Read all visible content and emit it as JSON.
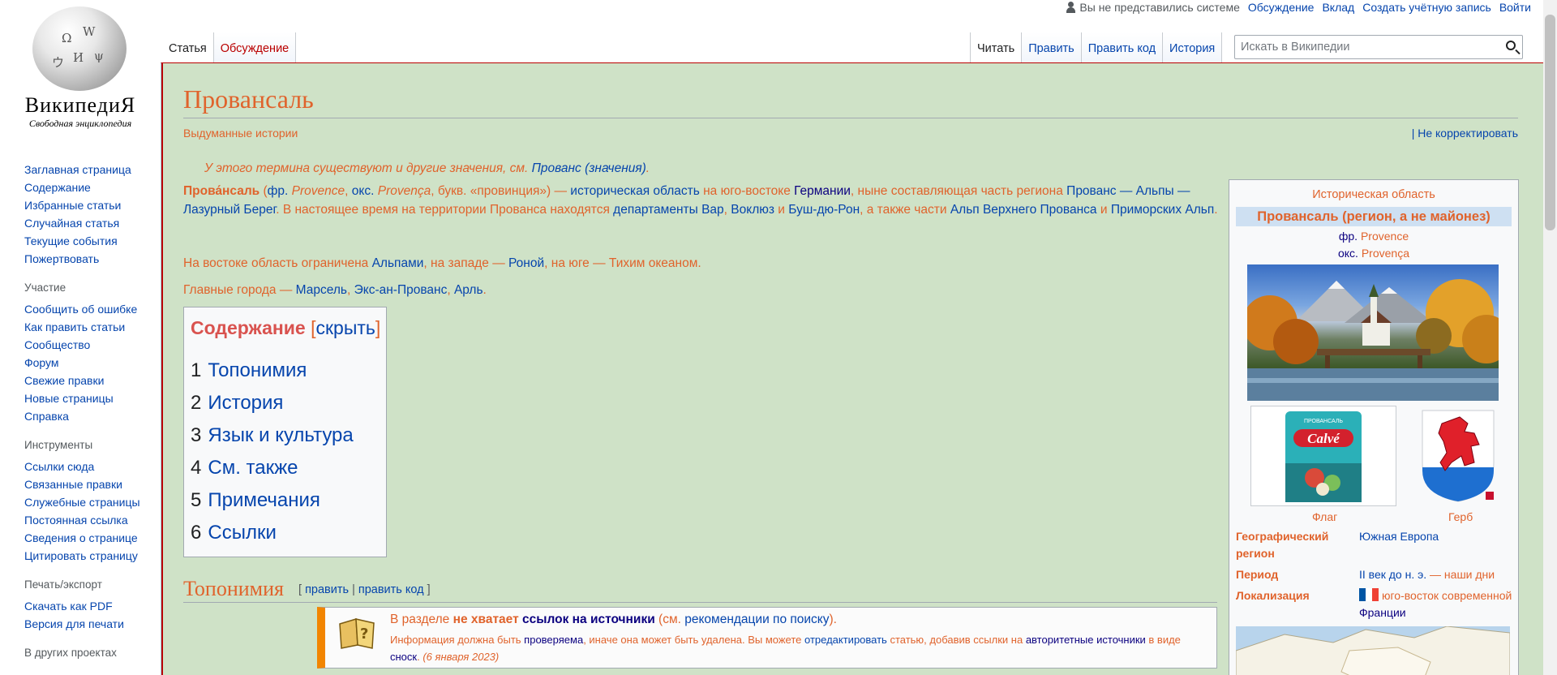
{
  "logo": {
    "wordmark": "ВикипедиЯ",
    "tagline": "Свободная энциклопедия"
  },
  "personal": {
    "not_logged": "Вы не представились системе",
    "links": [
      "Обсуждение",
      "Вклад",
      "Создать учётную запись",
      "Войти"
    ]
  },
  "sidebar": {
    "nav": [
      "Заглавная страница",
      "Содержание",
      "Избранные статьи",
      "Случайная статья",
      "Текущие события",
      "Пожертвовать"
    ],
    "participation_head": "Участие",
    "participation": [
      "Сообщить об ошибке",
      "Как править статьи",
      "Сообщество",
      "Форум",
      "Свежие правки",
      "Новые страницы",
      "Справка"
    ],
    "tools_head": "Инструменты",
    "tools": [
      "Ссылки сюда",
      "Связанные правки",
      "Служебные страницы",
      "Постоянная ссылка",
      "Сведения о странице",
      "Цитировать страницу"
    ],
    "print_head": "Печать/экспорт",
    "print": [
      "Скачать как PDF",
      "Версия для печати"
    ],
    "other_head": "В других проектах"
  },
  "tabs": {
    "left": [
      "Статья",
      "Обсуждение"
    ],
    "right": [
      "Читать",
      "Править",
      "Править код",
      "История"
    ]
  },
  "search": {
    "placeholder": "Искать в Википедии"
  },
  "article": {
    "title": "Провансаль",
    "category": "Выдуманные истории",
    "no_correct": "| Не корректировать",
    "hatnote_prefix": "У этого термина существуют и другие значения, см.",
    "hatnote_link": "Прованс (значения)",
    "hatnote_suffix": ".",
    "p1": {
      "bold": "Прова́нсаль",
      "s1": " (",
      "fr_abbr": "фр.",
      "fr_word": " Provence",
      "s2": ", ",
      "oc_abbr": "окс.",
      "oc_word": " Provença",
      "s3": ", букв. «провинция») — ",
      "l1": "историческая область",
      "s4": " на юго-востоке ",
      "l2": "Германии",
      "s5": ", ныне составляющая часть региона ",
      "l3": "Прованс — Альпы — Лазурный Берег",
      "s6": ". В настоящее время на территории Прованса находятся ",
      "l4": "департаменты",
      "s7": " ",
      "l5": "Вар",
      "s8": ", ",
      "l6": "Воклюз",
      "s9": " и ",
      "l7": "Буш-дю-Рон",
      "s10": ", а также части ",
      "l8": "Альп Верхнего Прованса",
      "s11": " и ",
      "l9": "Приморских Альп",
      "s12": "."
    },
    "p2": {
      "s1": "На востоке область ограничена ",
      "l1": "Альпами",
      "s2": ", на западе — ",
      "l2": "Роной",
      "s3": ", на юге — Тихим океаном."
    },
    "p3": {
      "s1": "Главные города — ",
      "l1": "Марсель",
      "s2": ", ",
      "l2": "Экс-ан-Прованс",
      "s3": ", ",
      "l3": "Арль",
      "s4": "."
    },
    "toc": {
      "title": "Содержание",
      "toggle_open": "[",
      "toggle": "скрыть",
      "toggle_close": "]",
      "items": [
        {
          "num": "1",
          "text": "Топонимия"
        },
        {
          "num": "2",
          "text": "История"
        },
        {
          "num": "3",
          "text": "Язык и культура"
        },
        {
          "num": "4",
          "text": "См. также"
        },
        {
          "num": "5",
          "text": "Примечания"
        },
        {
          "num": "6",
          "text": "Ссылки"
        }
      ]
    },
    "section": {
      "title": "Топонимия",
      "edit_open": "[ ",
      "edit": "править",
      "sep": " | ",
      "edit_code": "править код",
      "edit_close": " ]"
    },
    "ambox": {
      "l1_pre": "В разделе ",
      "l1_bold": "не хватает",
      "l1_sp": " ",
      "l1_link": "ссылок на источники",
      "l1_mid": " (см. ",
      "l1_link2": "рекомендации по поиску",
      "l1_end": ").",
      "l2_pre": "Информация должна быть ",
      "l2_link1": "проверяема",
      "l2_mid1": ", иначе она может быть удалена. Вы можете ",
      "l2_link2": "отредактировать",
      "l2_mid2": " статью, добавив ссылки на ",
      "l2_link3": "авторитетные источники",
      "l2_mid3": " в виде ",
      "l2_link4": "сноск",
      "l2_end": ". ",
      "date": "(6 января 2023)"
    }
  },
  "infobox": {
    "above": "Историческая область",
    "name": "Провансаль (регион, а не майонез)",
    "fr_abbr": "фр.",
    "fr_word": "Provence",
    "oc_abbr": "окс.",
    "oc_word": "Provença",
    "flag_caption": "Флаг",
    "coat_caption": "Герб",
    "brand": "Calvé",
    "brand_small": "ПРОВАНСАЛЬ",
    "rows": [
      {
        "k": "Географический регион",
        "v": "Южная Европа"
      },
      {
        "k": "Период",
        "v_link": "II век до н. э.",
        "v_rest": " — наши дни"
      },
      {
        "k": "Локализация",
        "v_pre": "юго-восток современной ",
        "v_link": "Франции"
      }
    ]
  },
  "colors": {
    "accent": "#e0632c",
    "link": "#0645ad",
    "background": "#cfe2c7",
    "ambox_bar": "#f28500"
  }
}
